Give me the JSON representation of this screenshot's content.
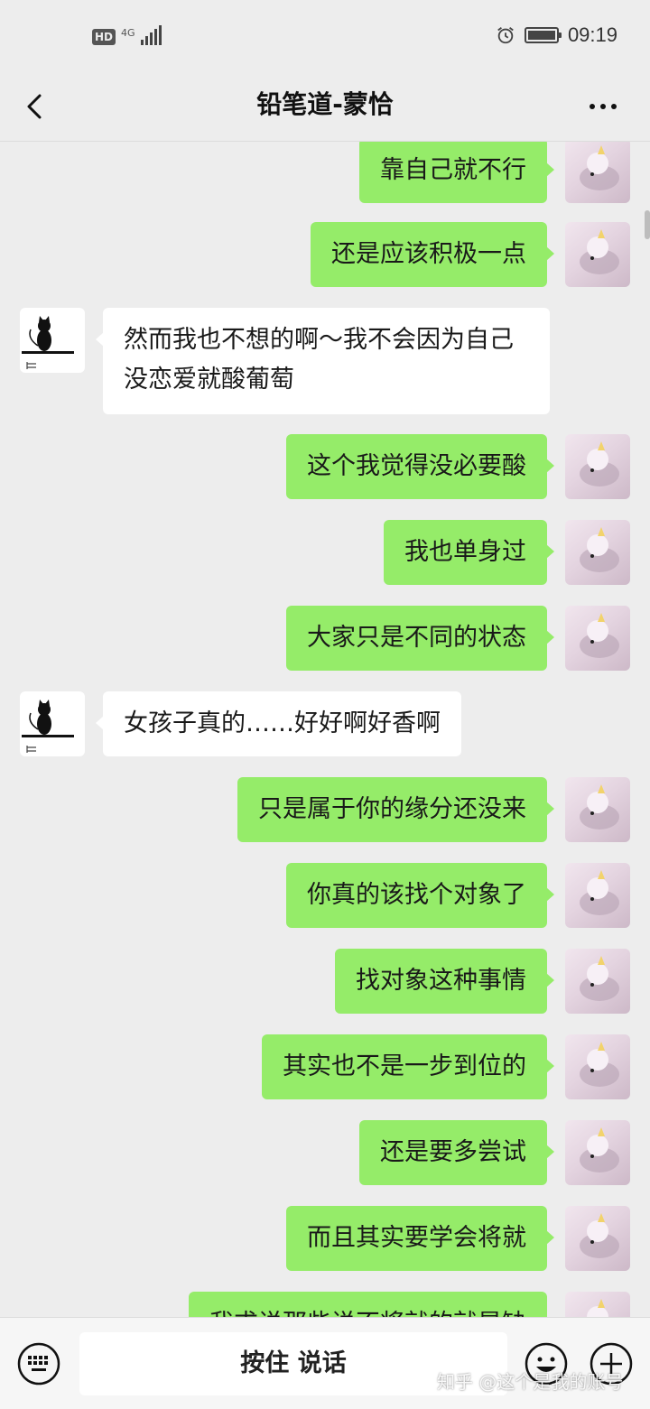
{
  "status_bar": {
    "hd": "HD",
    "network": "4G",
    "time": "09:19"
  },
  "header": {
    "title": "铅笔道-蒙恰"
  },
  "messages": [
    {
      "from": "me",
      "text": "靠自己就不行"
    },
    {
      "from": "me",
      "text": "还是应该积极一点"
    },
    {
      "from": "them",
      "text": "然而我也不想的啊～我不会因为自己没恋爱就酸葡萄"
    },
    {
      "from": "me",
      "text": "这个我觉得没必要酸"
    },
    {
      "from": "me",
      "text": "我也单身过"
    },
    {
      "from": "me",
      "text": "大家只是不同的状态"
    },
    {
      "from": "them",
      "text": "女孩子真的……好好啊好香啊"
    },
    {
      "from": "me",
      "text": "只是属于你的缘分还没来"
    },
    {
      "from": "me",
      "text": "你真的该找个对象了"
    },
    {
      "from": "me",
      "text": "找对象这种事情"
    },
    {
      "from": "me",
      "text": "其实也不是一步到位的"
    },
    {
      "from": "me",
      "text": "还是要多尝试"
    },
    {
      "from": "me",
      "text": "而且其实要学会将就"
    },
    {
      "from": "me",
      "text": "我求说那些说不将就的就是缺"
    }
  ],
  "input_bar": {
    "hold_to_talk": "按住 说话"
  },
  "watermark": "知乎 @这个是我的账号",
  "colors": {
    "my_bubble": "#95ec69",
    "their_bubble": "#ffffff",
    "background": "#ededed"
  }
}
